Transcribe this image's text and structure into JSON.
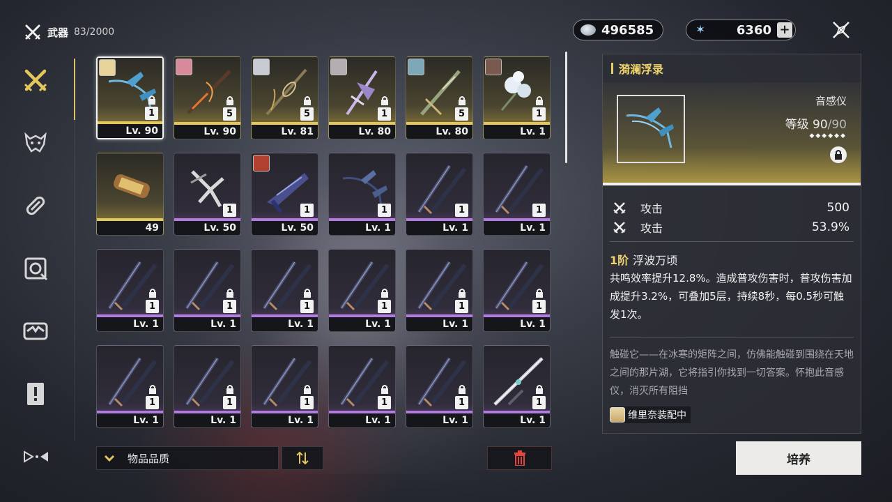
{
  "header": {
    "title": "武器",
    "count": "83/2000"
  },
  "currencies": [
    {
      "icon": "shell-credit-icon",
      "value": "496585"
    },
    {
      "icon": "astrite-icon",
      "value": "6360",
      "add_label": "+"
    }
  ],
  "sidebar": {
    "items": [
      {
        "icon": "weapon-icon",
        "active": true
      },
      {
        "icon": "echo-icon"
      },
      {
        "icon": "upgrade-material-icon"
      },
      {
        "icon": "development-material-icon"
      },
      {
        "icon": "resource-icon"
      },
      {
        "icon": "quest-item-icon"
      },
      {
        "icon": "more-icon"
      }
    ]
  },
  "weapons": [
    {
      "level": "Lv. 90",
      "rank": "1",
      "rarity": "gold",
      "avatar": "blonde",
      "locked": true,
      "selected": true,
      "art": "rectifier-blue"
    },
    {
      "level": "Lv. 90",
      "rank": "5",
      "rarity": "gold",
      "avatar": "pink",
      "locked": true,
      "art": "staff-fire"
    },
    {
      "level": "Lv. 81",
      "rank": "5",
      "rarity": "gold",
      "avatar": "silver",
      "locked": true,
      "art": "spear-gold"
    },
    {
      "level": "Lv. 80",
      "rank": "1",
      "rarity": "gold",
      "avatar": "grey",
      "locked": true,
      "art": "rectifier-purple"
    },
    {
      "level": "Lv. 80",
      "rank": "5",
      "rarity": "gold",
      "avatar": "teal",
      "locked": true,
      "art": "sword-green"
    },
    {
      "level": "Lv. 1",
      "rank": "1",
      "rarity": "gold",
      "avatar": "brown",
      "locked": true,
      "art": "flower-white"
    },
    {
      "level": "49",
      "rarity": "gold",
      "art": "tube-material"
    },
    {
      "level": "Lv. 50",
      "rank": "1",
      "rarity": "purple",
      "art": "gauntlet-white"
    },
    {
      "level": "Lv. 50",
      "rank": "1",
      "rarity": "purple",
      "avatar": "red",
      "art": "pistol-blue"
    },
    {
      "level": "Lv. 1",
      "rank": "1",
      "rarity": "purple",
      "art": "rectifier-dark"
    },
    {
      "level": "Lv. 1",
      "rank": "1",
      "rarity": "purple",
      "art": "sword-dark"
    },
    {
      "level": "Lv. 1",
      "rank": "1",
      "rarity": "purple",
      "art": "sword-dark"
    },
    {
      "level": "Lv. 1",
      "rank": "1",
      "rarity": "purple",
      "locked": true,
      "art": "sword-dark"
    },
    {
      "level": "Lv. 1",
      "rank": "1",
      "rarity": "purple",
      "locked": true,
      "art": "sword-dark"
    },
    {
      "level": "Lv. 1",
      "rank": "1",
      "rarity": "purple",
      "locked": true,
      "art": "sword-dark"
    },
    {
      "level": "Lv. 1",
      "rank": "1",
      "rarity": "purple",
      "locked": true,
      "art": "sword-dark"
    },
    {
      "level": "Lv. 1",
      "rank": "1",
      "rarity": "purple",
      "locked": true,
      "art": "sword-dark"
    },
    {
      "level": "Lv. 1",
      "rank": "1",
      "rarity": "purple",
      "locked": true,
      "art": "sword-dark"
    },
    {
      "level": "Lv. 1",
      "rank": "1",
      "rarity": "purple",
      "locked": true,
      "art": "sword-dark"
    },
    {
      "level": "Lv. 1",
      "rank": "1",
      "rarity": "purple",
      "locked": true,
      "art": "sword-dark"
    },
    {
      "level": "Lv. 1",
      "rank": "1",
      "rarity": "purple",
      "locked": true,
      "art": "sword-dark"
    },
    {
      "level": "Lv. 1",
      "rank": "1",
      "rarity": "purple",
      "locked": true,
      "art": "sword-dark"
    },
    {
      "level": "Lv. 1",
      "rank": "1",
      "rarity": "purple",
      "locked": true,
      "art": "sword-dark"
    },
    {
      "level": "Lv. 1",
      "rank": "1",
      "rarity": "purple",
      "locked": true,
      "art": "sword-silver"
    }
  ],
  "toolbar": {
    "filter_label": "物品品质",
    "sort_icon": "sort-icon",
    "delete_icon": "trash-icon"
  },
  "detail": {
    "name": "漪澜浮录",
    "type": "音感仪",
    "level_label": "等级",
    "level_value": "90",
    "level_max": "/90",
    "stars": "◆◆◆◆◆◆",
    "stats": [
      {
        "label": "攻击",
        "value": "500"
      },
      {
        "label": "攻击",
        "value": "53.9%"
      }
    ],
    "skill_rank": "1阶",
    "skill_name": "浮波万顷",
    "skill_desc": "共鸣效率提升12.8%。造成普攻伤害时，普攻伤害加成提升3.2%，可叠加5层，持续8秒，每0.5秒可触发1次。",
    "lore": "触碰它——在冰寒的矩阵之间，仿佛能触碰到围绕在天地之间的那片湖，它将指引你找到一切答案。怀抱此音感仪，消灭所有阻挡",
    "equipped": "维里奈装配中"
  },
  "cultivate_label": "培养",
  "colors": {
    "gold": "#e4c75c",
    "purple": "#b47be0",
    "accent": "#efd36b"
  }
}
